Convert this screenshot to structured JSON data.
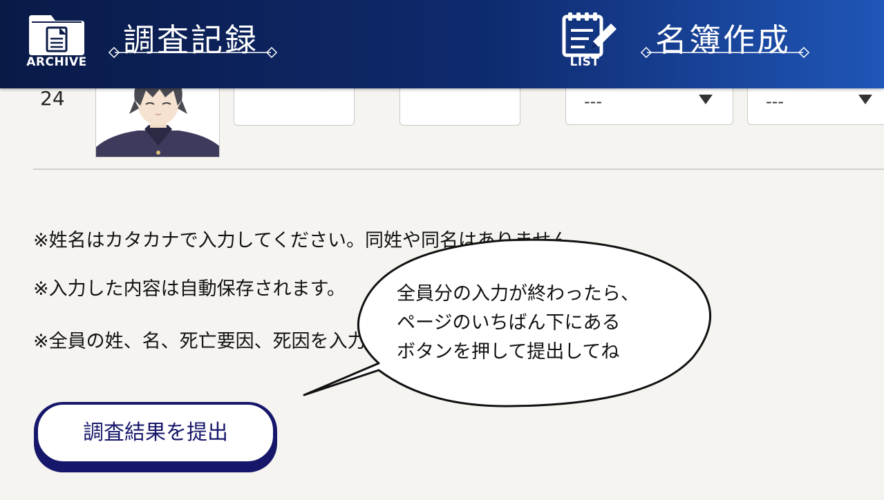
{
  "header": {
    "archive": {
      "caption": "ARCHIVE",
      "title": "調査記録",
      "icon": "archive-folder-icon"
    },
    "list": {
      "caption": "LIST",
      "title": "名簿作成",
      "icon": "list-notepad-icon"
    }
  },
  "row": {
    "number": "24",
    "surname_value": "",
    "given_name_value": "",
    "death_factor_select": "---",
    "death_cause_select": "---"
  },
  "notes": [
    "※姓名はカタカナで入力してください。同姓や同名はありません。",
    "※入力した内容は自動保存されます。",
    "※全員の姓、名、死亡要因、死因を入力して提出してください。"
  ],
  "submit_button": {
    "label": "調査結果を提出"
  },
  "speech_bubble": {
    "lines": [
      "全員分の入力が終わったら、",
      "ページのいちばん下にある",
      "ボタンを押して提出してね"
    ]
  },
  "colors": {
    "header_start": "#0a1a47",
    "header_end": "#2056b8",
    "accent": "#16176a",
    "background": "#f5f4f0"
  }
}
